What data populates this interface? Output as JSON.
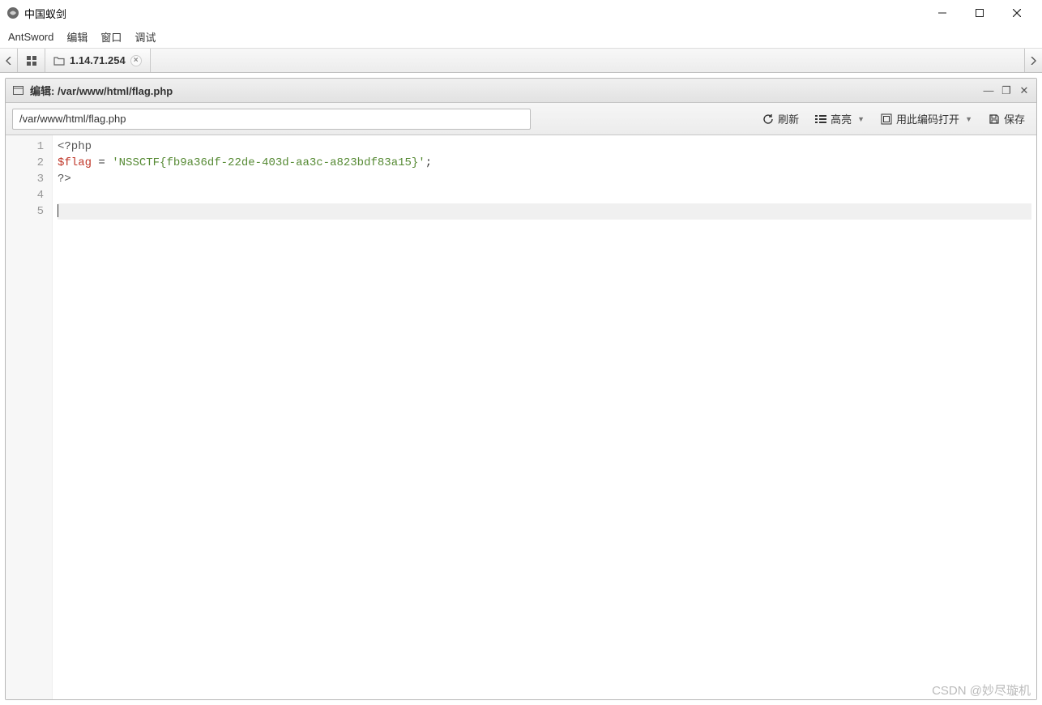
{
  "window": {
    "title": "中国蚁剑"
  },
  "menu": {
    "items": [
      "AntSword",
      "编辑",
      "窗口",
      "调试"
    ]
  },
  "tabs": {
    "items": [
      {
        "label": "1.14.71.254"
      }
    ]
  },
  "panel": {
    "title_prefix": "编辑: ",
    "title_path": "/var/www/html/flag.php",
    "path_value": "/var/www/html/flag.php",
    "buttons": {
      "refresh": "刷新",
      "highlight": "高亮",
      "encoding": "用此编码打开",
      "save": "保存"
    }
  },
  "editor": {
    "lines": [
      {
        "n": "1",
        "tokens": [
          {
            "t": "tag",
            "v": "<?php"
          }
        ]
      },
      {
        "n": "2",
        "tokens": [
          {
            "t": "var",
            "v": "$flag"
          },
          {
            "t": "plain",
            "v": " "
          },
          {
            "t": "op",
            "v": "="
          },
          {
            "t": "plain",
            "v": " "
          },
          {
            "t": "str",
            "v": "'NSSCTF{fb9a36df-22de-403d-aa3c-a823bdf83a15}'"
          },
          {
            "t": "plain",
            "v": ";"
          }
        ]
      },
      {
        "n": "3",
        "tokens": [
          {
            "t": "tag",
            "v": "?>"
          }
        ]
      },
      {
        "n": "4",
        "tokens": []
      },
      {
        "n": "5",
        "tokens": [],
        "active": true
      }
    ]
  },
  "watermark": "CSDN @妙尽璇机"
}
